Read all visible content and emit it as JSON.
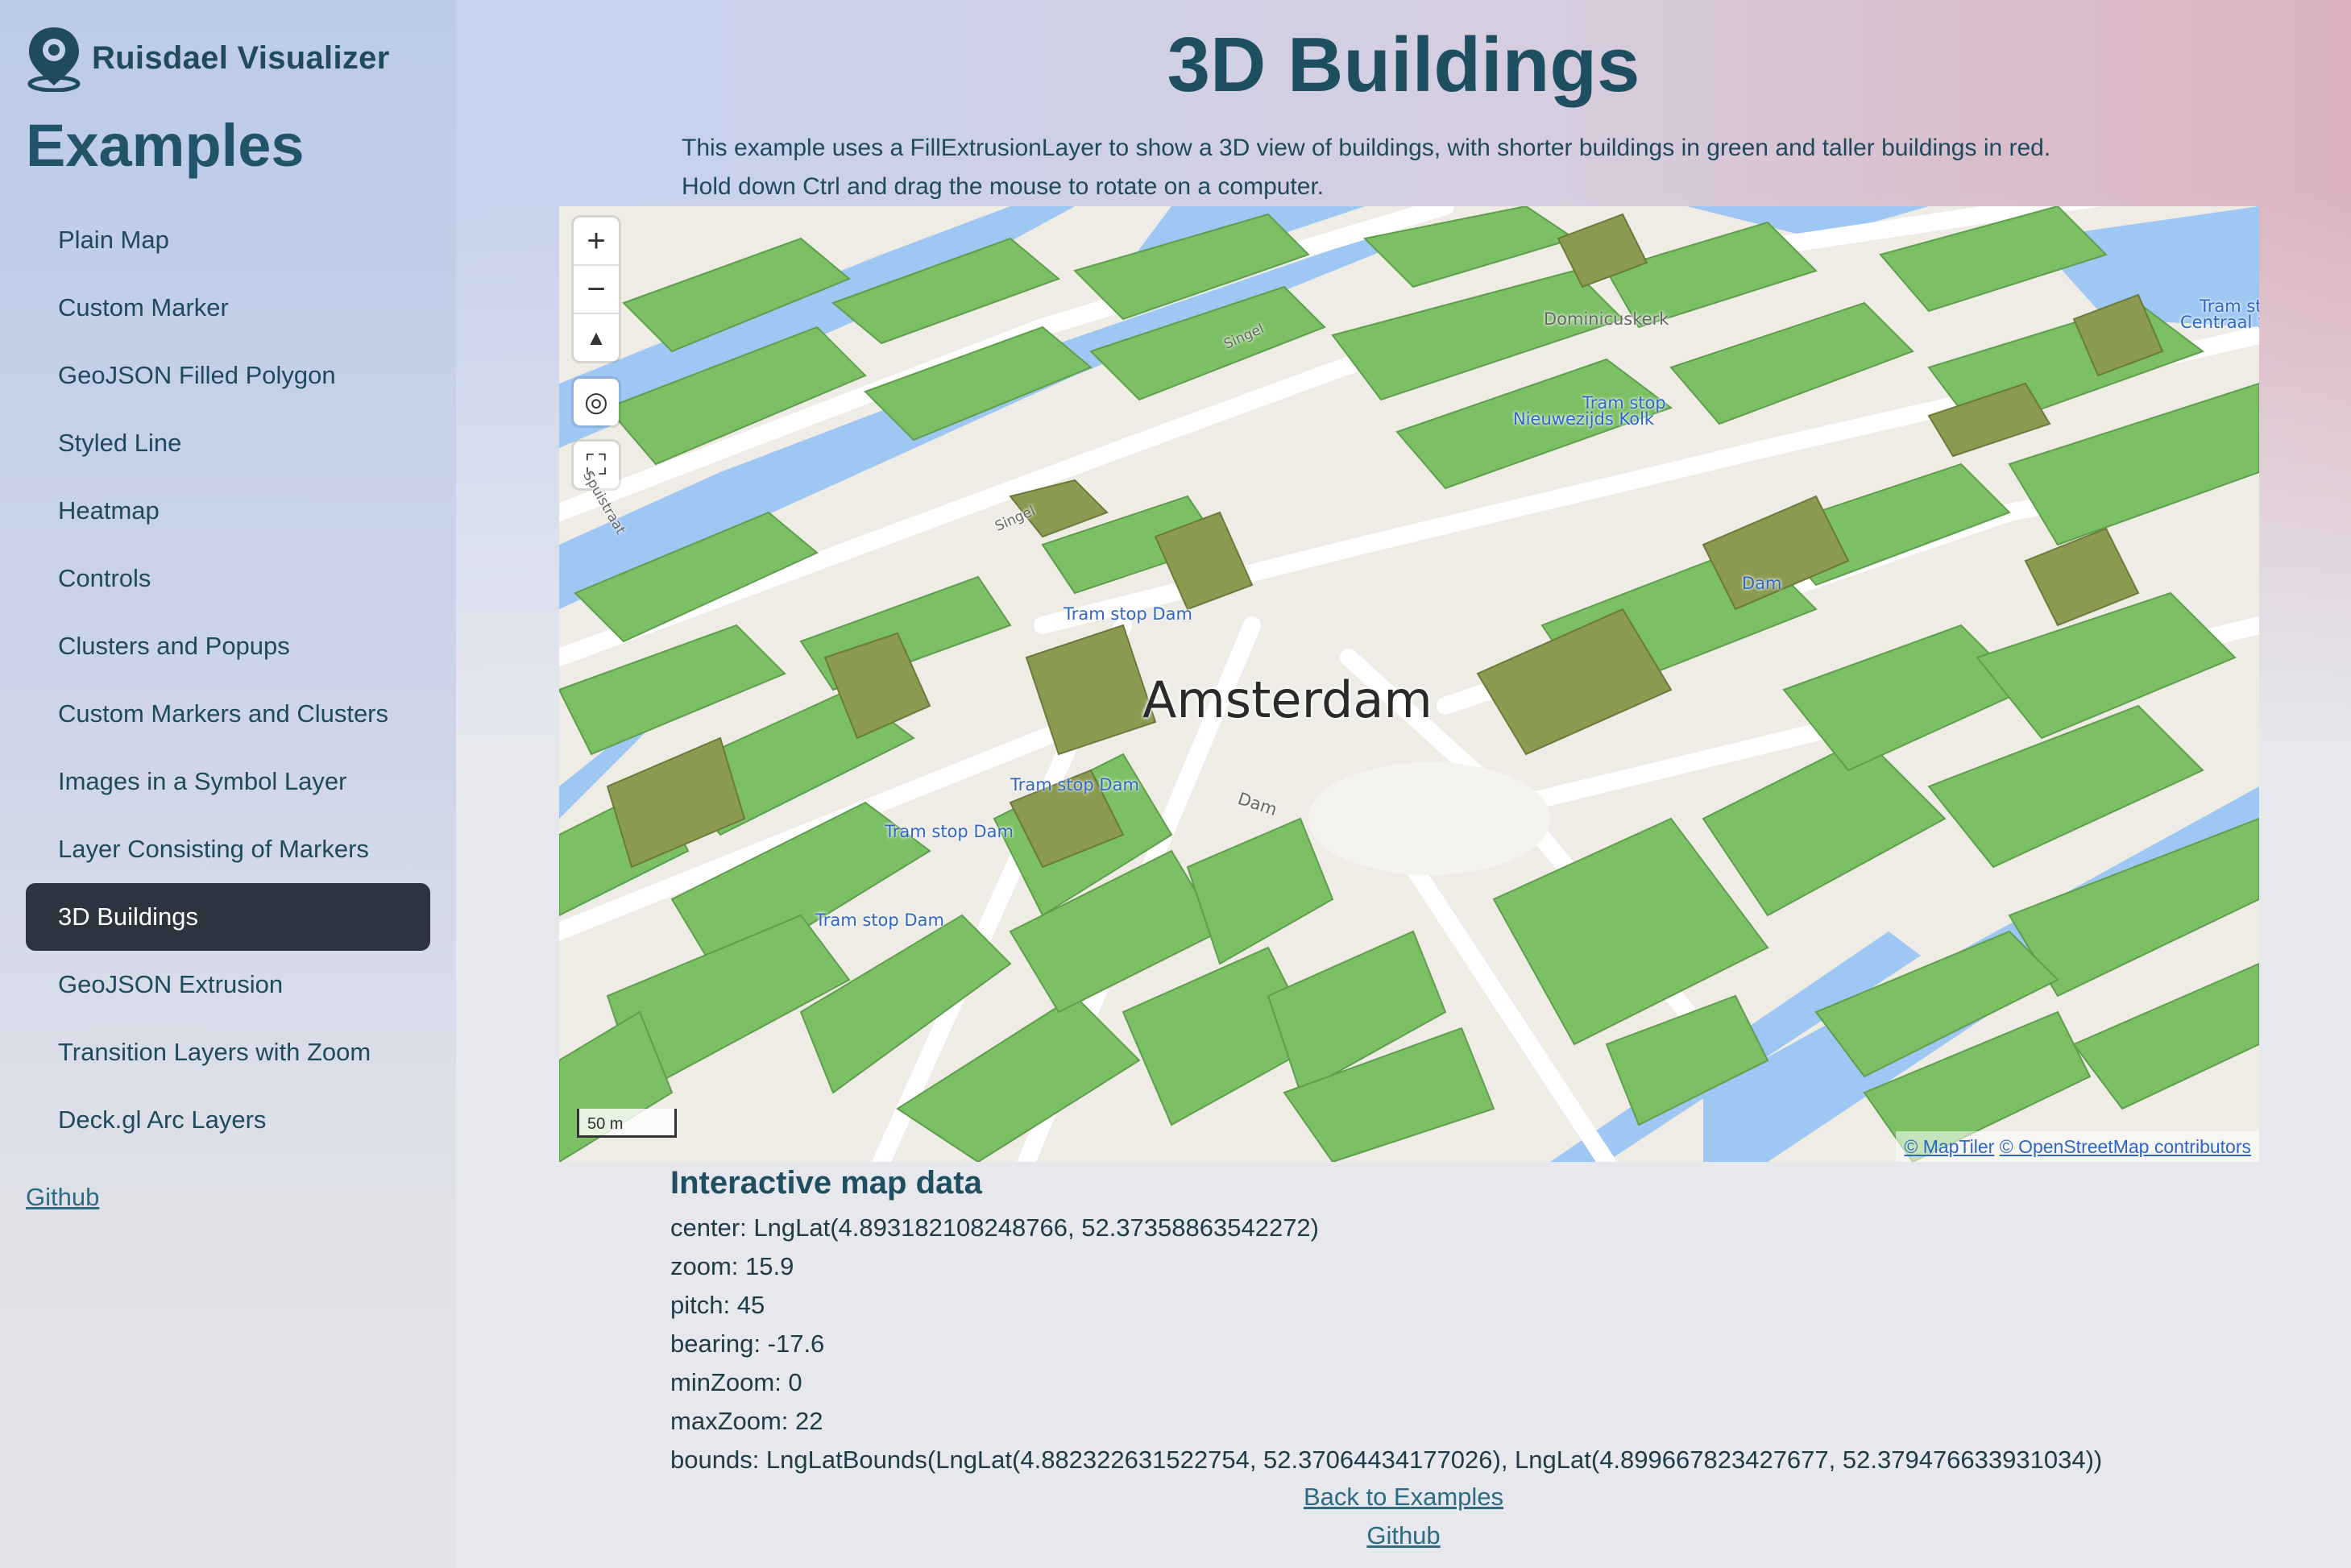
{
  "brand": {
    "name": "Ruisdael Visualizer"
  },
  "sidebar": {
    "title": "Examples",
    "items": [
      {
        "label": "Plain Map"
      },
      {
        "label": "Custom Marker"
      },
      {
        "label": "GeoJSON Filled Polygon"
      },
      {
        "label": "Styled Line"
      },
      {
        "label": "Heatmap"
      },
      {
        "label": "Controls"
      },
      {
        "label": "Clusters and Popups"
      },
      {
        "label": "Custom Markers and Clusters"
      },
      {
        "label": "Images in a Symbol Layer"
      },
      {
        "label": "Layer Consisting of Markers"
      },
      {
        "label": "3D Buildings",
        "active": true
      },
      {
        "label": "GeoJSON Extrusion"
      },
      {
        "label": "Transition Layers with Zoom"
      },
      {
        "label": "Deck.gl Arc Layers"
      }
    ],
    "github": "Github"
  },
  "page": {
    "title": "3D Buildings",
    "description_line1": "This example uses a FillExtrusionLayer to show a 3D view of buildings, with shorter buildings in green and taller buildings in red.",
    "description_line2": "Hold down Ctrl and drag the mouse to rotate on a computer."
  },
  "map": {
    "city_label": "Amsterdam",
    "labels": {
      "tram_dam_1": "Tram stop Dam",
      "tram_dam_2": "Tram stop Dam",
      "tram_dam_3": "Tram stop Dam",
      "tram_dam_4": "Tram stop Dam",
      "tram_kolk_1": "Tram stop",
      "tram_kolk_2": "Nieuwezijds Kolk",
      "dam_stop": "Dam",
      "church": "Dominicuskerk",
      "central_1": "Tram sto",
      "central_2": "Centraal St",
      "street_dam": "Dam",
      "street_singel1": "Singel",
      "street_singel2": "Singel",
      "street_spuistraat": "Spuistraat"
    },
    "controls": {
      "zoom_in": "+",
      "zoom_out": "−",
      "compass": "▲",
      "locate": "◎",
      "fullscreen": "⛶"
    },
    "scale_label": "50 m",
    "attribution_maptiler": "© MapTiler",
    "attribution_osm": "© OpenStreetMap contributors",
    "colors": {
      "building": "#7cc065",
      "tall_building": "#8a9a50",
      "water": "#9ec7f3",
      "road": "#ffffff",
      "ground": "#eeece5"
    }
  },
  "map_data": {
    "heading": "Interactive map data",
    "center": "center: LngLat(4.893182108248766, 52.37358863542272)",
    "zoom": "zoom: 15.9",
    "pitch": "pitch: 45",
    "bearing": "bearing: -17.6",
    "min_zoom": "minZoom: 0",
    "max_zoom": "maxZoom: 22",
    "bounds": "bounds: LngLatBounds(LngLat(4.882322631522754, 52.37064434177026), LngLat(4.899667823427677, 52.379476633931034))"
  },
  "footer": {
    "back_label": "Back to Examples",
    "github_label": "Github"
  }
}
